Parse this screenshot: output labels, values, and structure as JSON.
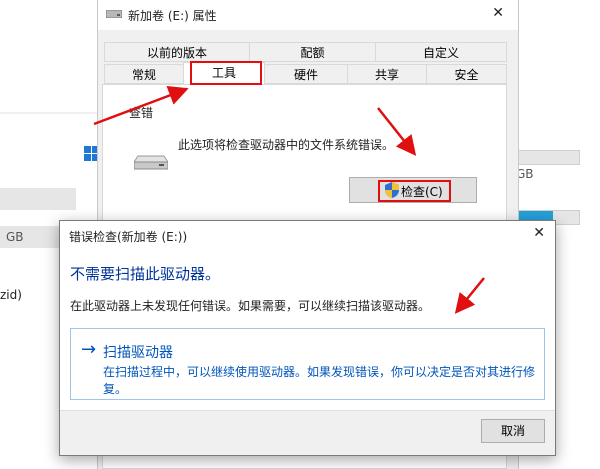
{
  "background": {
    "gb_left": "GB",
    "gb_right": "GB",
    "partial_text": "zid)"
  },
  "properties_window": {
    "title": "新加卷 (E:) 属性",
    "close_icon": "close-icon",
    "tabs_row1": [
      "以前的版本",
      "配额",
      "自定义"
    ],
    "tabs_row2": [
      "常规",
      "工具",
      "硬件",
      "共享",
      "安全"
    ],
    "selected_tab": "工具",
    "group_label": "查错",
    "check_description": "此选项将检查驱动器中的文件系统错误。",
    "check_button_label": "检查(C)"
  },
  "dialog": {
    "title": "错误检查(新加卷 (E:))",
    "heading": "不需要扫描此驱动器。",
    "description": "在此驱动器上未发现任何错误。如果需要，可以继续扫描该驱动器。",
    "scan_option_arrow": "→",
    "scan_option_title": "扫描驱动器",
    "scan_option_description": "在扫描过程中，可以继续使用驱动器。如果发现错误，你可以决定是否对其进行修复。",
    "cancel_label": "取消"
  },
  "colors": {
    "annotation_red": "#e01010",
    "link_blue": "#0055bb",
    "heading_blue": "#003399"
  }
}
